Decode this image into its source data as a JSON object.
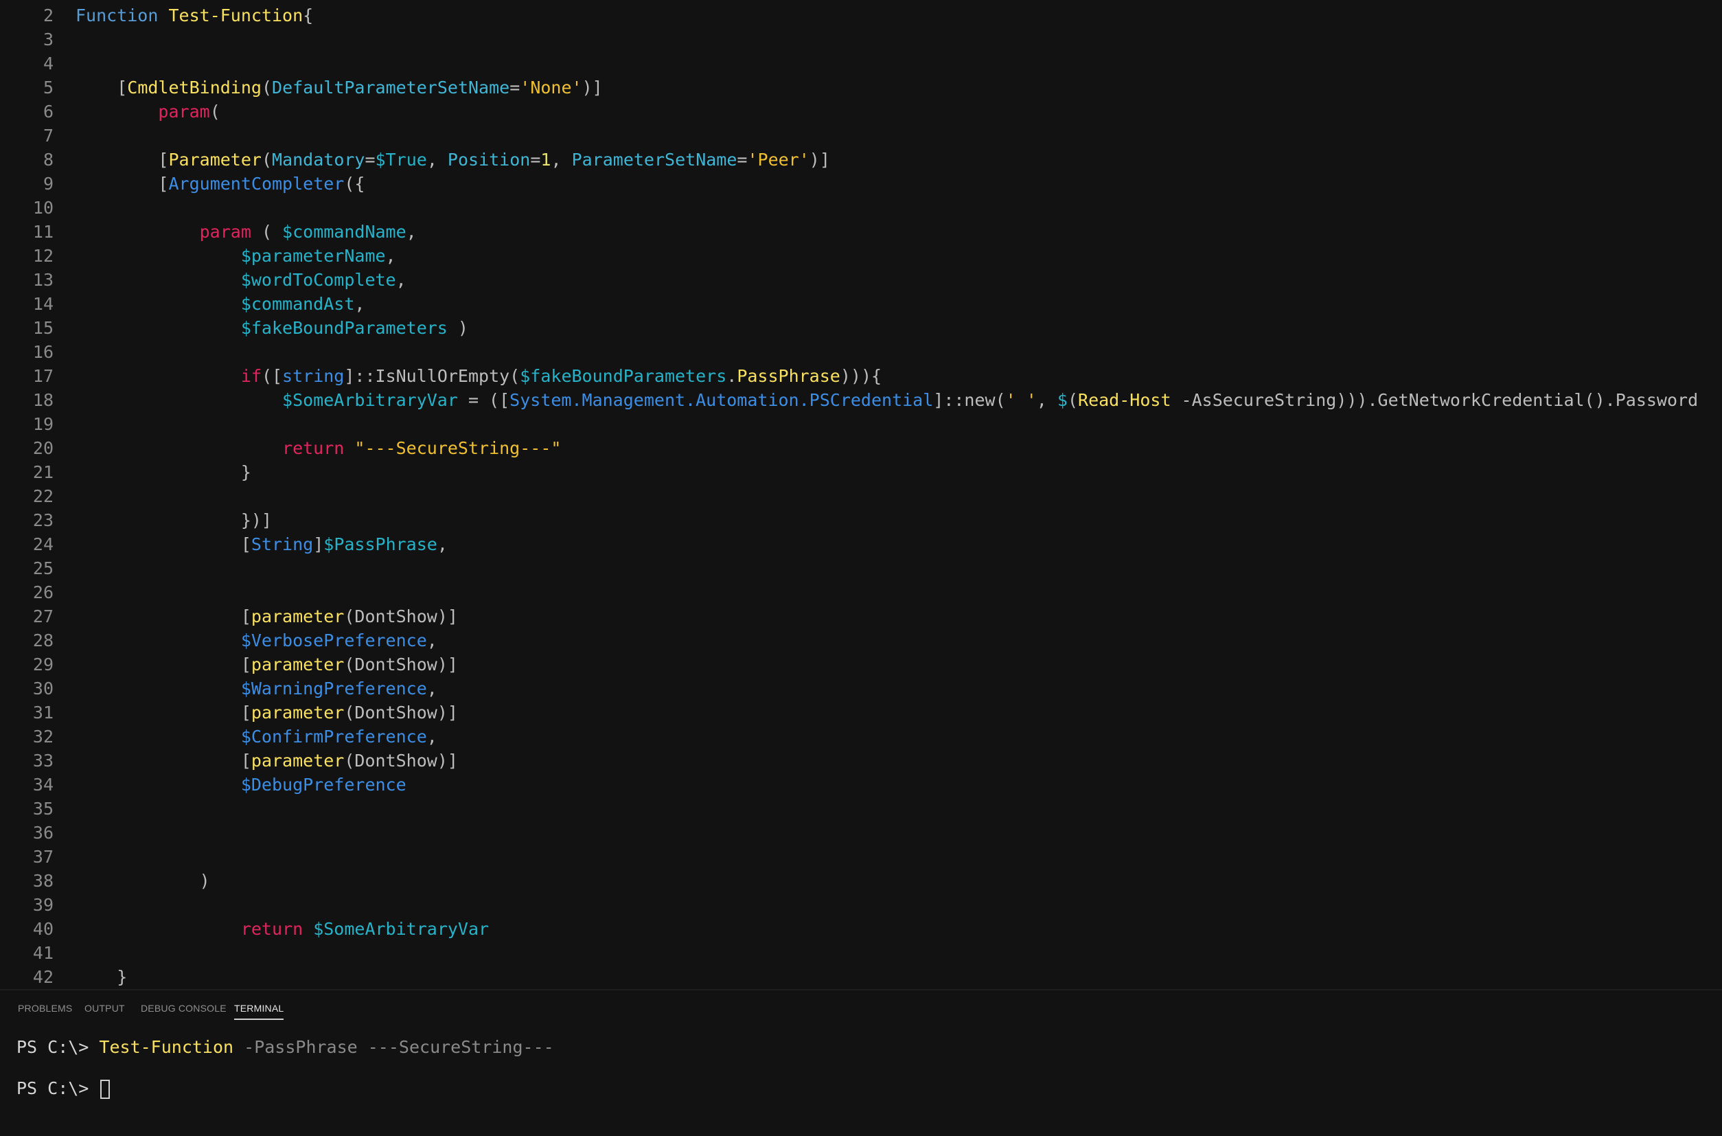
{
  "editor": {
    "lines": [
      {
        "n": "2",
        "tokens": [
          [
            "kw",
            "Function"
          ],
          [
            "plain",
            " "
          ],
          [
            "fn",
            "Test-Function"
          ],
          [
            "punc",
            "{"
          ]
        ]
      },
      {
        "n": "3",
        "tokens": []
      },
      {
        "n": "4",
        "tokens": []
      },
      {
        "n": "5",
        "tokens": [
          [
            "plain",
            "    "
          ],
          [
            "punc",
            "["
          ],
          [
            "attr",
            "CmdletBinding"
          ],
          [
            "punc",
            "("
          ],
          [
            "param",
            "DefaultParameterSetName"
          ],
          [
            "punc",
            "="
          ],
          [
            "str",
            "'None'"
          ],
          [
            "punc",
            ")]"
          ]
        ]
      },
      {
        "n": "6",
        "tokens": [
          [
            "plain",
            "        "
          ],
          [
            "ctl",
            "param"
          ],
          [
            "punc",
            "("
          ]
        ]
      },
      {
        "n": "7",
        "tokens": []
      },
      {
        "n": "8",
        "tokens": [
          [
            "plain",
            "        "
          ],
          [
            "punc",
            "["
          ],
          [
            "attr",
            "Parameter"
          ],
          [
            "punc",
            "("
          ],
          [
            "param",
            "Mandatory"
          ],
          [
            "punc",
            "="
          ],
          [
            "var",
            "$True"
          ],
          [
            "punc",
            ", "
          ],
          [
            "param",
            "Position"
          ],
          [
            "punc",
            "="
          ],
          [
            "num",
            "1"
          ],
          [
            "punc",
            ", "
          ],
          [
            "param",
            "ParameterSetName"
          ],
          [
            "punc",
            "="
          ],
          [
            "str",
            "'Peer'"
          ],
          [
            "punc",
            ")]"
          ]
        ]
      },
      {
        "n": "9",
        "tokens": [
          [
            "plain",
            "        "
          ],
          [
            "punc",
            "["
          ],
          [
            "type",
            "ArgumentCompleter"
          ],
          [
            "punc",
            "({"
          ]
        ]
      },
      {
        "n": "10",
        "tokens": []
      },
      {
        "n": "11",
        "tokens": [
          [
            "plain",
            "            "
          ],
          [
            "ctl",
            "param"
          ],
          [
            "punc",
            " ( "
          ],
          [
            "var",
            "$commandName"
          ],
          [
            "punc",
            ","
          ]
        ]
      },
      {
        "n": "12",
        "tokens": [
          [
            "plain",
            "                "
          ],
          [
            "var",
            "$parameterName"
          ],
          [
            "punc",
            ","
          ]
        ]
      },
      {
        "n": "13",
        "tokens": [
          [
            "plain",
            "                "
          ],
          [
            "var",
            "$wordToComplete"
          ],
          [
            "punc",
            ","
          ]
        ]
      },
      {
        "n": "14",
        "tokens": [
          [
            "plain",
            "                "
          ],
          [
            "var",
            "$commandAst"
          ],
          [
            "punc",
            ","
          ]
        ]
      },
      {
        "n": "15",
        "tokens": [
          [
            "plain",
            "                "
          ],
          [
            "var",
            "$fakeBoundParameters"
          ],
          [
            "punc",
            " )"
          ]
        ]
      },
      {
        "n": "16",
        "tokens": []
      },
      {
        "n": "17",
        "tokens": [
          [
            "plain",
            "                "
          ],
          [
            "ctl",
            "if"
          ],
          [
            "punc",
            "(["
          ],
          [
            "type",
            "string"
          ],
          [
            "punc",
            "]::IsNullOrEmpty("
          ],
          [
            "var",
            "$fakeBoundParameters"
          ],
          [
            "punc",
            "."
          ],
          [
            "fn",
            "PassPhrase"
          ],
          [
            "punc",
            "))){"
          ]
        ]
      },
      {
        "n": "18",
        "tokens": [
          [
            "plain",
            "                    "
          ],
          [
            "var",
            "$SomeArbitraryVar"
          ],
          [
            "punc",
            " = (["
          ],
          [
            "type",
            "System.Management.Automation.PSCredential"
          ],
          [
            "punc",
            "]::new("
          ],
          [
            "str",
            "' '"
          ],
          [
            "punc",
            ", "
          ],
          [
            "var",
            "$"
          ],
          [
            "punc",
            "("
          ],
          [
            "fn",
            "Read-Host"
          ],
          [
            "plain",
            " -AsSecureString"
          ],
          [
            "punc",
            "))).GetNetworkCredential().Password"
          ]
        ]
      },
      {
        "n": "19",
        "tokens": []
      },
      {
        "n": "20",
        "tokens": [
          [
            "plain",
            "                    "
          ],
          [
            "ctl",
            "return"
          ],
          [
            "plain",
            " "
          ],
          [
            "str",
            "\"---SecureString---\""
          ]
        ]
      },
      {
        "n": "21",
        "tokens": [
          [
            "plain",
            "                "
          ],
          [
            "punc",
            "}"
          ]
        ]
      },
      {
        "n": "22",
        "tokens": []
      },
      {
        "n": "23",
        "tokens": [
          [
            "plain",
            "                "
          ],
          [
            "punc",
            "})]"
          ]
        ]
      },
      {
        "n": "24",
        "tokens": [
          [
            "plain",
            "                "
          ],
          [
            "punc",
            "["
          ],
          [
            "type",
            "String"
          ],
          [
            "punc",
            "]"
          ],
          [
            "var",
            "$PassPhrase"
          ],
          [
            "punc",
            ","
          ]
        ]
      },
      {
        "n": "25",
        "tokens": []
      },
      {
        "n": "26",
        "tokens": []
      },
      {
        "n": "27",
        "tokens": [
          [
            "plain",
            "                "
          ],
          [
            "punc",
            "["
          ],
          [
            "attr",
            "parameter"
          ],
          [
            "punc",
            "(DontShow)]"
          ]
        ]
      },
      {
        "n": "28",
        "tokens": [
          [
            "plain",
            "                "
          ],
          [
            "pvar",
            "$VerbosePreference"
          ],
          [
            "punc",
            ","
          ]
        ]
      },
      {
        "n": "29",
        "tokens": [
          [
            "plain",
            "                "
          ],
          [
            "punc",
            "["
          ],
          [
            "attr",
            "parameter"
          ],
          [
            "punc",
            "(DontShow)]"
          ]
        ]
      },
      {
        "n": "30",
        "tokens": [
          [
            "plain",
            "                "
          ],
          [
            "pvar",
            "$WarningPreference"
          ],
          [
            "punc",
            ","
          ]
        ]
      },
      {
        "n": "31",
        "tokens": [
          [
            "plain",
            "                "
          ],
          [
            "punc",
            "["
          ],
          [
            "attr",
            "parameter"
          ],
          [
            "punc",
            "(DontShow)]"
          ]
        ]
      },
      {
        "n": "32",
        "tokens": [
          [
            "plain",
            "                "
          ],
          [
            "pvar",
            "$ConfirmPreference"
          ],
          [
            "punc",
            ","
          ]
        ]
      },
      {
        "n": "33",
        "tokens": [
          [
            "plain",
            "                "
          ],
          [
            "punc",
            "["
          ],
          [
            "attr",
            "parameter"
          ],
          [
            "punc",
            "(DontShow)]"
          ]
        ]
      },
      {
        "n": "34",
        "tokens": [
          [
            "plain",
            "                "
          ],
          [
            "pvar",
            "$DebugPreference"
          ]
        ]
      },
      {
        "n": "35",
        "tokens": []
      },
      {
        "n": "36",
        "tokens": []
      },
      {
        "n": "37",
        "tokens": []
      },
      {
        "n": "38",
        "tokens": [
          [
            "plain",
            "            "
          ],
          [
            "punc",
            ")"
          ]
        ]
      },
      {
        "n": "39",
        "tokens": []
      },
      {
        "n": "40",
        "tokens": [
          [
            "plain",
            "                "
          ],
          [
            "ctl",
            "return"
          ],
          [
            "plain",
            " "
          ],
          [
            "var",
            "$SomeArbitraryVar"
          ]
        ]
      },
      {
        "n": "41",
        "tokens": []
      },
      {
        "n": "42",
        "tokens": [
          [
            "plain",
            "    "
          ],
          [
            "punc",
            "}"
          ]
        ]
      }
    ]
  },
  "panel": {
    "tabs": [
      {
        "label": "PROBLEMS",
        "active": false
      },
      {
        "label": "OUTPUT",
        "active": false
      },
      {
        "label": "DEBUG CONSOLE",
        "active": false
      },
      {
        "label": "TERMINAL",
        "active": true
      }
    ],
    "terminal": {
      "line1": {
        "prompt": "PS C:\\> ",
        "command": "Test-Function",
        "args": " -PassPhrase ---SecureString---"
      },
      "line2": {
        "prompt": "PS C:\\> "
      }
    }
  }
}
